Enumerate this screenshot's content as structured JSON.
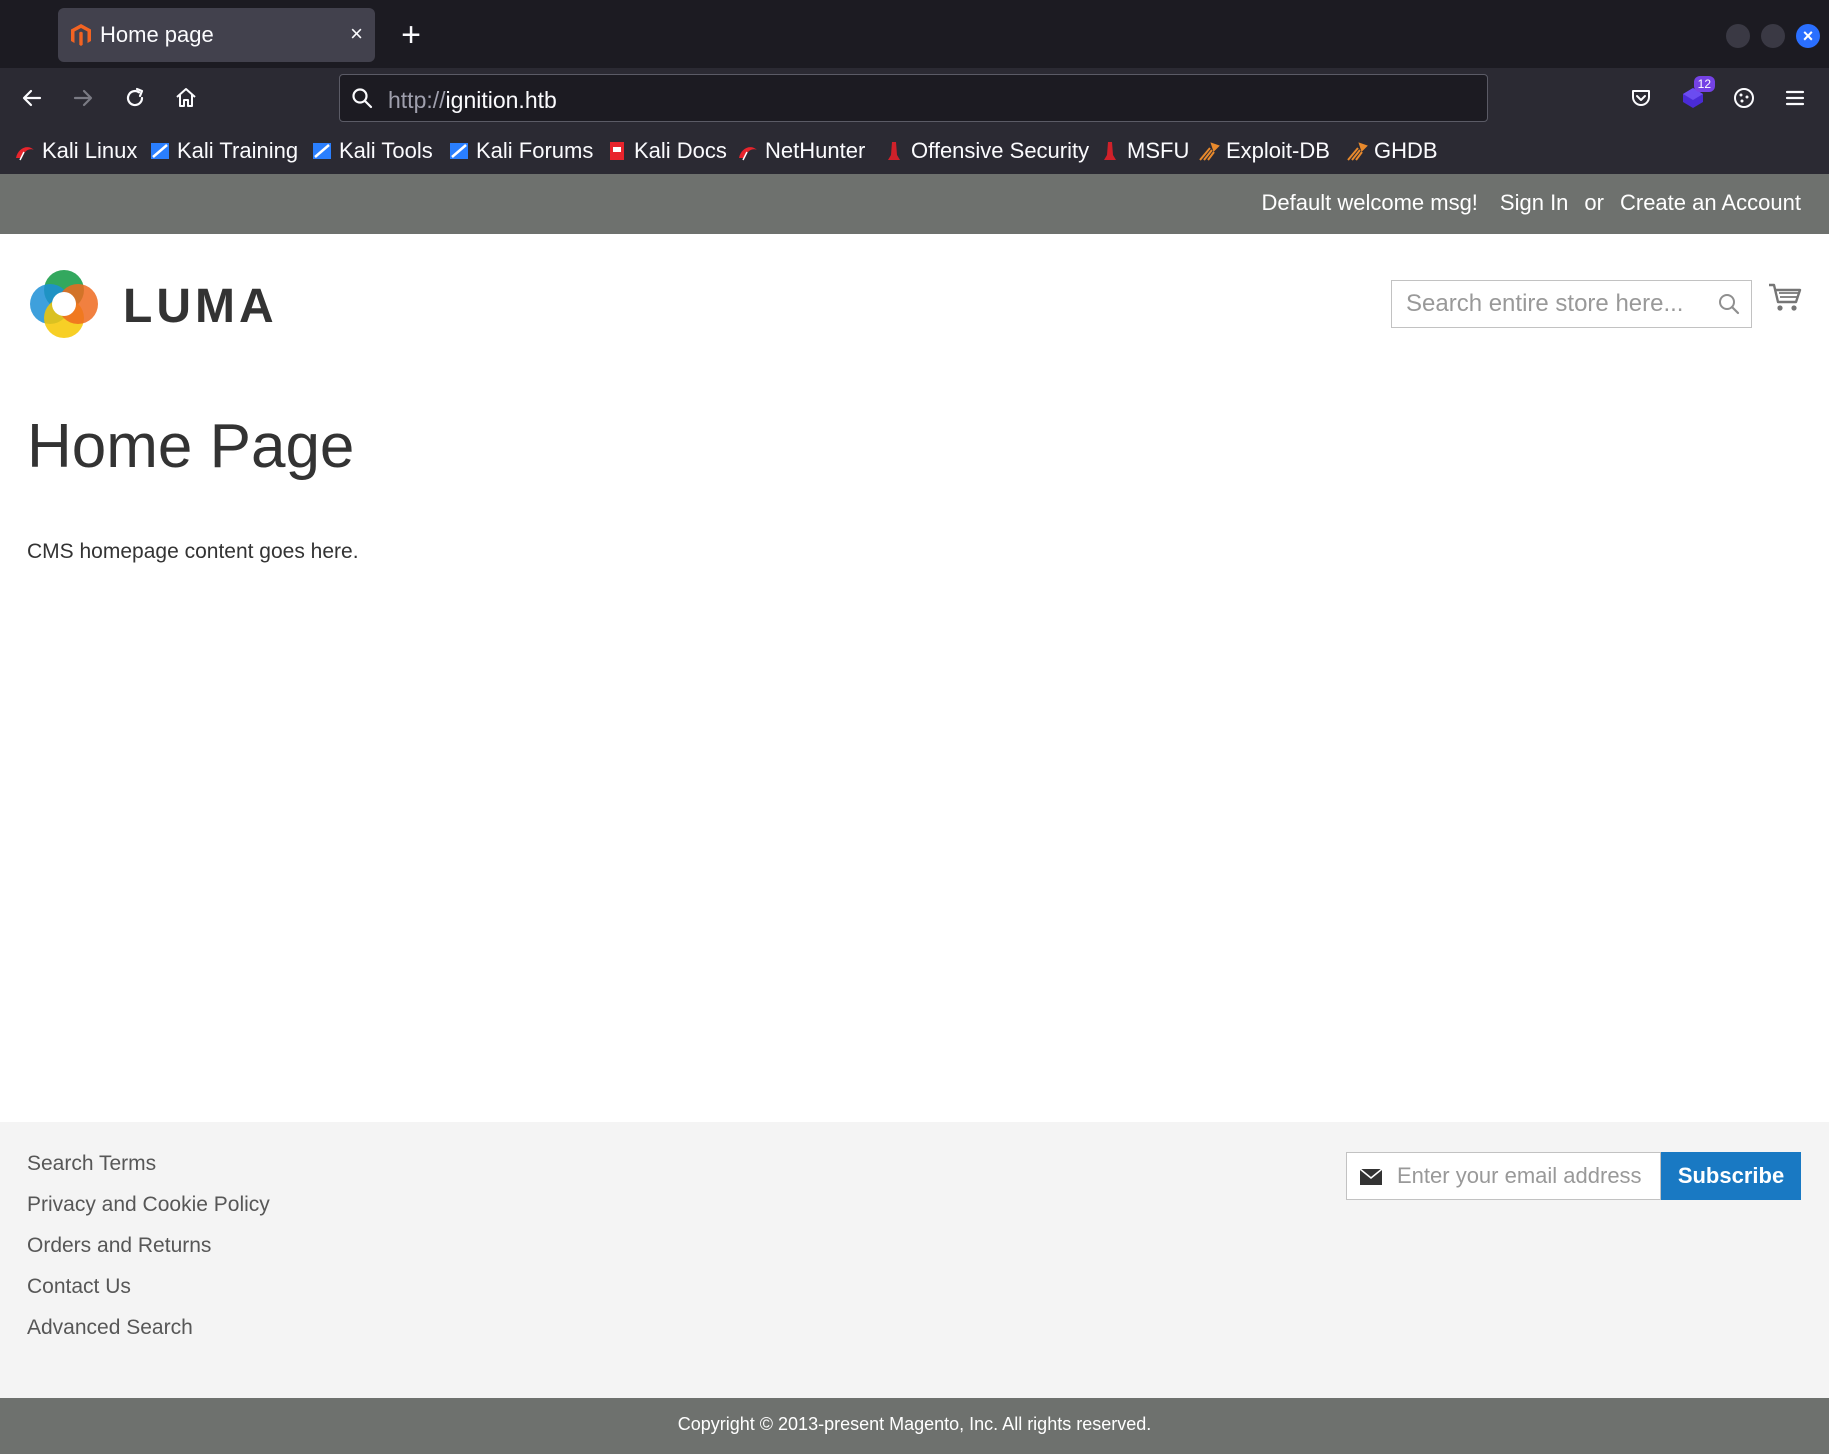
{
  "browser": {
    "tab": {
      "title": "Home page",
      "close": "×"
    },
    "new_tab": "+",
    "window_close": "×",
    "url": {
      "scheme": "http://",
      "host": "ignition.htb"
    },
    "extension_badge": "12",
    "bookmarks": [
      {
        "label": "Kali Linux",
        "icon": "kali-dragon-icon",
        "color": "#e8242c"
      },
      {
        "label": "Kali Training",
        "icon": "kali-training-icon",
        "color": "#2a7fff"
      },
      {
        "label": "Kali Tools",
        "icon": "kali-tools-icon",
        "color": "#2a7fff"
      },
      {
        "label": "Kali Forums",
        "icon": "kali-forums-icon",
        "color": "#2a7fff"
      },
      {
        "label": "Kali Docs",
        "icon": "kali-docs-icon",
        "color": "#e8242c"
      },
      {
        "label": "NetHunter",
        "icon": "nethunter-icon",
        "color": "#e8242c"
      },
      {
        "label": "Offensive Security",
        "icon": "offsec-icon",
        "color": "#d0212a"
      },
      {
        "label": "MSFU",
        "icon": "msfu-icon",
        "color": "#d0212a"
      },
      {
        "label": "Exploit-DB",
        "icon": "exploit-db-icon",
        "color": "#e8892c"
      },
      {
        "label": "GHDB",
        "icon": "ghdb-icon",
        "color": "#e8892c"
      }
    ]
  },
  "header": {
    "welcome": "Default welcome msg!",
    "sign_in": "Sign In",
    "or": "or",
    "create_account": "Create an Account"
  },
  "logo": {
    "text": "LUMA"
  },
  "search": {
    "placeholder": "Search entire store here..."
  },
  "main": {
    "title": "Home Page",
    "content": "CMS homepage content goes here."
  },
  "footer": {
    "links": [
      "Search Terms",
      "Privacy and Cookie Policy",
      "Orders and Returns",
      "Contact Us",
      "Advanced Search"
    ],
    "newsletter": {
      "placeholder": "Enter your email address",
      "button": "Subscribe"
    },
    "copyright": "Copyright © 2013-present Magento, Inc. All rights reserved."
  },
  "colors": {
    "header_bar": "#6e716e",
    "subscribe_button": "#1979c3",
    "footer_bg": "#f4f4f4"
  }
}
